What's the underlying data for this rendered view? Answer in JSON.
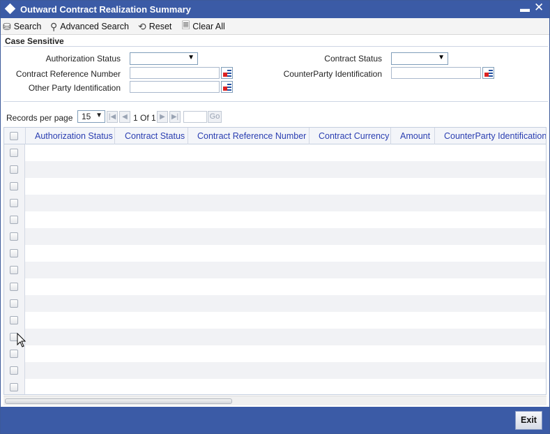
{
  "window": {
    "title": "Outward Contract Realization Summary"
  },
  "toolbar": {
    "search_label": "Search",
    "advanced_search_label": "Advanced Search",
    "reset_label": "Reset",
    "clear_all_label": "Clear All"
  },
  "criteria": {
    "case_sensitive_label": "Case Sensitive",
    "authorization_status_label": "Authorization Status",
    "authorization_status_value": "",
    "contract_status_label": "Contract Status",
    "contract_status_value": "",
    "contract_reference_label": "Contract Reference Number",
    "contract_reference_value": "",
    "counterparty_id_label": "CounterParty Identification",
    "counterparty_id_value": "",
    "other_party_id_label": "Other Party Identification",
    "other_party_id_value": ""
  },
  "paging": {
    "records_per_page_label": "Records per page",
    "records_per_page_value": "15",
    "page_indicator": "1 Of 1",
    "go_label": "Go"
  },
  "grid": {
    "columns": [
      "Authorization Status",
      "Contract Status",
      "Contract Reference Number",
      "Contract Currency",
      "Amount",
      "CounterParty Identification"
    ],
    "rows": []
  },
  "footer": {
    "exit_label": "Exit"
  },
  "colors": {
    "header_blue": "#3b5ba6",
    "column_text": "#2a3eb1"
  }
}
